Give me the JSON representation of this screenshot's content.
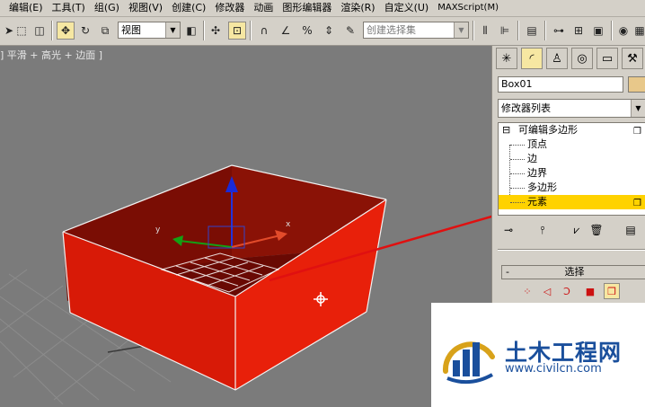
{
  "menu": {
    "items": [
      "编辑(E)",
      "工具(T)",
      "组(G)",
      "视图(V)",
      "创建(C)",
      "修改器",
      "动画",
      "图形编辑器",
      "渲染(R)",
      "自定义(U)",
      "MAXScript(M)"
    ]
  },
  "toolbar": {
    "reference_coord": "视图",
    "named_selection_placeholder": "创建选择集"
  },
  "viewport": {
    "label": "] 平滑 + 高光 + 边面 ]",
    "box_color": "#e21b07",
    "axis_labels": {
      "x": "x",
      "y": "y"
    }
  },
  "panel": {
    "object_name": "Box01",
    "modifier_list": "修改器列表",
    "stack": {
      "root": "可编辑多边形",
      "sub_objects": [
        "顶点",
        "边",
        "边界",
        "多边形",
        "元素"
      ],
      "selected": "元素"
    },
    "rollout_title": "选择",
    "accent_color": "#ffd200"
  },
  "watermark": {
    "title": "土木工程网",
    "url": "www.civilcn.com"
  }
}
